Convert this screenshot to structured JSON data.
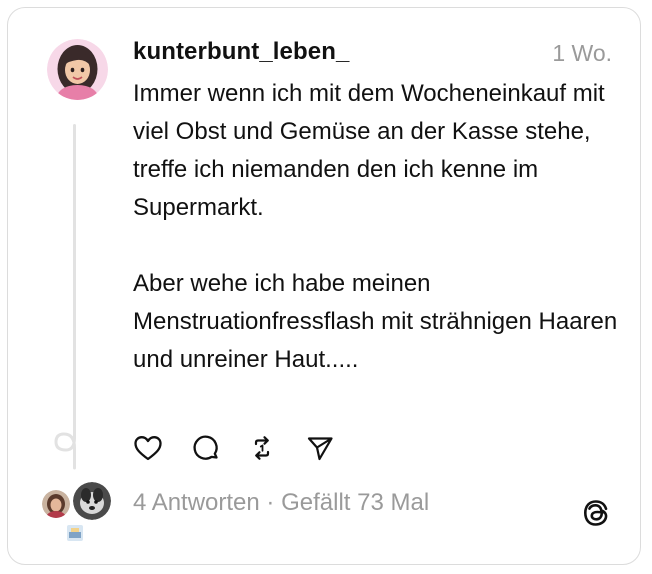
{
  "post": {
    "username": "kunterbunt_leben_",
    "timestamp": "1 Wo.",
    "paragraphs": [
      "Immer wenn ich mit dem Wocheneinkauf mit viel Obst und Gemüse an der Kasse stehe, treffe ich niemanden den ich kenne im Supermarkt.",
      "Aber wehe ich habe meinen Menstruationfressflash mit strähnigen Haaren und unreiner Haut....."
    ]
  },
  "actions": {
    "icons": [
      "heart-icon",
      "comment-icon",
      "repost-icon",
      "share-icon"
    ]
  },
  "footer": {
    "replies": "4 Antworten",
    "separator": "·",
    "likes": "Gefällt 73 Mal",
    "logo": "threads-logo-icon"
  },
  "colors": {
    "text": "#111111",
    "muted": "#9a9a9a",
    "border": "#dcdcdc",
    "thread_line": "#e2e2e2"
  }
}
